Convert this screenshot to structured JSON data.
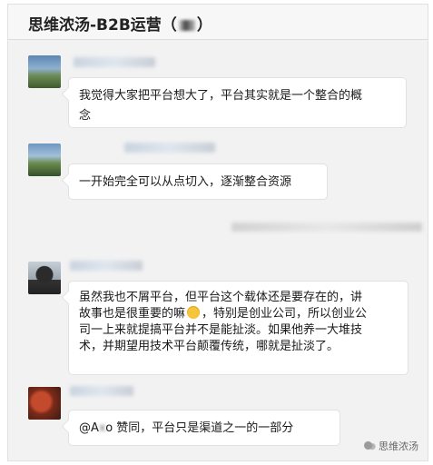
{
  "chat": {
    "title": "思维浓汤-B2B运营（",
    "title_close": "）"
  },
  "messages": [
    {
      "avatar": "mountain-avatar-icon",
      "lines": [
        "我觉得大家把平台想大了，平台其实就是一个整合的概",
        "念"
      ]
    },
    {
      "avatar": "mountain-avatar-icon",
      "lines": [
        "一开始完全可以从点切入，逐渐整合资源"
      ]
    },
    {
      "avatar": "person-avatar-icon",
      "lines": [
        "虽然我也不屑平台，但平台这个载体还是要存在的，讲",
        "故事也是很重要的嘛",
        "，特别是创业公司，所以创业公",
        "司一上来就提搞平台并不是能扯淡。如果他养一大堆技",
        "术，并期望用技术平台颠覆传统，哪就是扯淡了。"
      ]
    },
    {
      "avatar": "red-avatar-icon",
      "lines": [
        "@A",
        "x",
        "o 赞同，平台只是渠道之一的一部分"
      ]
    }
  ],
  "watermark": {
    "text": "思维浓汤"
  },
  "colors": {
    "bubble": "#ffffff",
    "background": "#f2f2f2"
  }
}
